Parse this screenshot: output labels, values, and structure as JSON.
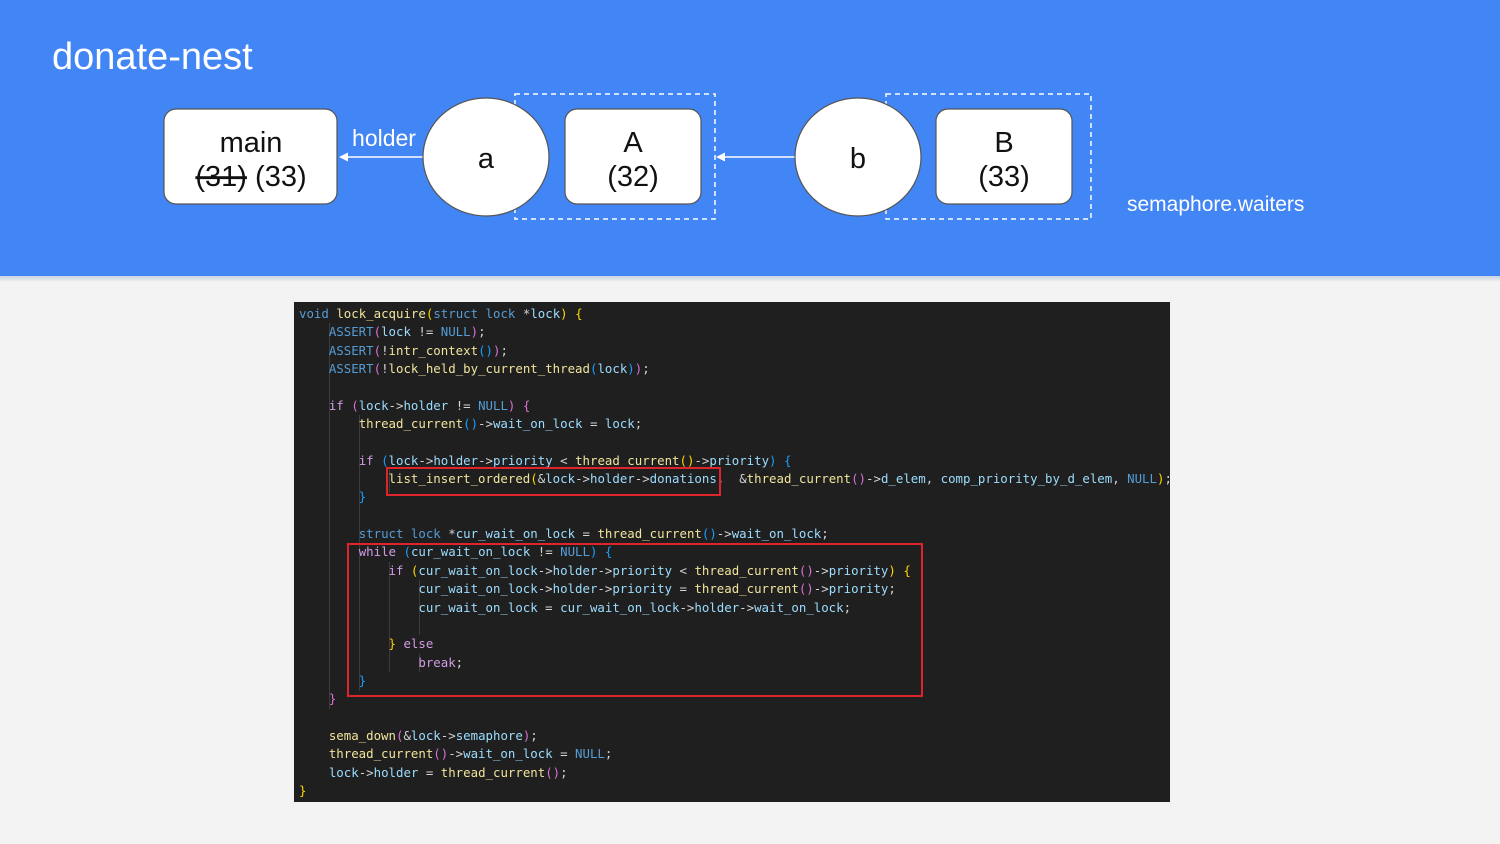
{
  "slide": {
    "title": "donate-nest"
  },
  "diagram": {
    "threads": [
      {
        "id": "main",
        "name": "main",
        "old_priority": "(31)",
        "priority": "(33)"
      },
      {
        "id": "A",
        "name": "A",
        "priority": "(32)"
      },
      {
        "id": "B",
        "name": "B",
        "priority": "(33)"
      }
    ],
    "locks": [
      {
        "id": "a",
        "label": "a"
      },
      {
        "id": "b",
        "label": "b"
      }
    ],
    "edge_label": "holder",
    "waiters_label": "semaphore.waiters"
  },
  "code": {
    "language": "c",
    "lines": [
      [
        [
          "ty",
          "void"
        ],
        [
          "op",
          " "
        ],
        [
          "fn",
          "lock_acquire"
        ],
        [
          "br1",
          "("
        ],
        [
          "ty",
          "struct"
        ],
        [
          "op",
          " "
        ],
        [
          "ty",
          "lock"
        ],
        [
          "op",
          " *"
        ],
        [
          "id",
          "lock"
        ],
        [
          "br1",
          ")"
        ],
        [
          "op",
          " "
        ],
        [
          "br1",
          "{"
        ]
      ],
      [
        [
          "op",
          "    "
        ],
        [
          "ty",
          "ASSERT"
        ],
        [
          "br2",
          "("
        ],
        [
          "id",
          "lock"
        ],
        [
          "op",
          " != "
        ],
        [
          "ty",
          "NULL"
        ],
        [
          "br2",
          ")"
        ],
        [
          "op",
          ";"
        ]
      ],
      [
        [
          "op",
          "    "
        ],
        [
          "ty",
          "ASSERT"
        ],
        [
          "br2",
          "("
        ],
        [
          "op",
          "!"
        ],
        [
          "fn",
          "intr_context"
        ],
        [
          "br3",
          "()"
        ],
        [
          "br2",
          ")"
        ],
        [
          "op",
          ";"
        ]
      ],
      [
        [
          "op",
          "    "
        ],
        [
          "ty",
          "ASSERT"
        ],
        [
          "br2",
          "("
        ],
        [
          "op",
          "!"
        ],
        [
          "fn",
          "lock_held_by_current_thread"
        ],
        [
          "br3",
          "("
        ],
        [
          "id",
          "lock"
        ],
        [
          "br3",
          ")"
        ],
        [
          "br2",
          ")"
        ],
        [
          "op",
          ";"
        ]
      ],
      [
        [
          "op",
          ""
        ]
      ],
      [
        [
          "op",
          "    "
        ],
        [
          "kw",
          "if"
        ],
        [
          "op",
          " "
        ],
        [
          "br2",
          "("
        ],
        [
          "id",
          "lock"
        ],
        [
          "op",
          "->"
        ],
        [
          "id",
          "holder"
        ],
        [
          "op",
          " != "
        ],
        [
          "ty",
          "NULL"
        ],
        [
          "br2",
          ")"
        ],
        [
          "op",
          " "
        ],
        [
          "br2",
          "{"
        ]
      ],
      [
        [
          "op",
          "        "
        ],
        [
          "fn",
          "thread_current"
        ],
        [
          "br3",
          "()"
        ],
        [
          "op",
          "->"
        ],
        [
          "id",
          "wait_on_lock"
        ],
        [
          "op",
          " = "
        ],
        [
          "id",
          "lock"
        ],
        [
          "op",
          ";"
        ]
      ],
      [
        [
          "op",
          ""
        ]
      ],
      [
        [
          "op",
          "        "
        ],
        [
          "kw",
          "if"
        ],
        [
          "op",
          " "
        ],
        [
          "br3",
          "("
        ],
        [
          "id",
          "lock"
        ],
        [
          "op",
          "->"
        ],
        [
          "id",
          "holder"
        ],
        [
          "op",
          "->"
        ],
        [
          "id",
          "priority"
        ],
        [
          "op",
          " < "
        ],
        [
          "fn",
          "thread_current"
        ],
        [
          "br1",
          "()"
        ],
        [
          "op",
          "->"
        ],
        [
          "id",
          "priority"
        ],
        [
          "br3",
          ")"
        ],
        [
          "op",
          " "
        ],
        [
          "br3",
          "{"
        ]
      ],
      [
        [
          "op",
          "            "
        ],
        [
          "fn",
          "list_insert_ordered"
        ],
        [
          "br1",
          "("
        ],
        [
          "op",
          "&"
        ],
        [
          "id",
          "lock"
        ],
        [
          "op",
          "->"
        ],
        [
          "id",
          "holder"
        ],
        [
          "op",
          "->"
        ],
        [
          "id",
          "donations"
        ],
        [
          "op",
          ",  &"
        ],
        [
          "fn",
          "thread_current"
        ],
        [
          "br2",
          "()"
        ],
        [
          "op",
          "->"
        ],
        [
          "id",
          "d_elem"
        ],
        [
          "op",
          ", "
        ],
        [
          "id",
          "comp_priority_by_d_elem"
        ],
        [
          "op",
          ", "
        ],
        [
          "ty",
          "NULL"
        ],
        [
          "br1",
          ")"
        ],
        [
          "op",
          ";"
        ]
      ],
      [
        [
          "op",
          "        "
        ],
        [
          "br3",
          "}"
        ]
      ],
      [
        [
          "op",
          ""
        ]
      ],
      [
        [
          "op",
          "        "
        ],
        [
          "ty",
          "struct"
        ],
        [
          "op",
          " "
        ],
        [
          "ty",
          "lock"
        ],
        [
          "op",
          " *"
        ],
        [
          "id",
          "cur_wait_on_lock"
        ],
        [
          "op",
          " = "
        ],
        [
          "fn",
          "thread_current"
        ],
        [
          "br3",
          "()"
        ],
        [
          "op",
          "->"
        ],
        [
          "id",
          "wait_on_lock"
        ],
        [
          "op",
          ";"
        ]
      ],
      [
        [
          "op",
          "        "
        ],
        [
          "kw",
          "while"
        ],
        [
          "op",
          " "
        ],
        [
          "br3",
          "("
        ],
        [
          "id",
          "cur_wait_on_lock"
        ],
        [
          "op",
          " != "
        ],
        [
          "ty",
          "NULL"
        ],
        [
          "br3",
          ")"
        ],
        [
          "op",
          " "
        ],
        [
          "br3",
          "{"
        ]
      ],
      [
        [
          "op",
          "            "
        ],
        [
          "kw",
          "if"
        ],
        [
          "op",
          " "
        ],
        [
          "br1",
          "("
        ],
        [
          "id",
          "cur_wait_on_lock"
        ],
        [
          "op",
          "->"
        ],
        [
          "id",
          "holder"
        ],
        [
          "op",
          "->"
        ],
        [
          "id",
          "priority"
        ],
        [
          "op",
          " < "
        ],
        [
          "fn",
          "thread_current"
        ],
        [
          "br2",
          "()"
        ],
        [
          "op",
          "->"
        ],
        [
          "id",
          "priority"
        ],
        [
          "br1",
          ")"
        ],
        [
          "op",
          " "
        ],
        [
          "br1",
          "{"
        ]
      ],
      [
        [
          "op",
          "                "
        ],
        [
          "id",
          "cur_wait_on_lock"
        ],
        [
          "op",
          "->"
        ],
        [
          "id",
          "holder"
        ],
        [
          "op",
          "->"
        ],
        [
          "id",
          "priority"
        ],
        [
          "op",
          " = "
        ],
        [
          "fn",
          "thread_current"
        ],
        [
          "br2",
          "()"
        ],
        [
          "op",
          "->"
        ],
        [
          "id",
          "priority"
        ],
        [
          "op",
          ";"
        ]
      ],
      [
        [
          "op",
          "                "
        ],
        [
          "id",
          "cur_wait_on_lock"
        ],
        [
          "op",
          " = "
        ],
        [
          "id",
          "cur_wait_on_lock"
        ],
        [
          "op",
          "->"
        ],
        [
          "id",
          "holder"
        ],
        [
          "op",
          "->"
        ],
        [
          "id",
          "wait_on_lock"
        ],
        [
          "op",
          ";"
        ]
      ],
      [
        [
          "op",
          ""
        ]
      ],
      [
        [
          "op",
          "            "
        ],
        [
          "br1",
          "}"
        ],
        [
          "op",
          " "
        ],
        [
          "kw",
          "else"
        ]
      ],
      [
        [
          "op",
          "                "
        ],
        [
          "kw",
          "break"
        ],
        [
          "op",
          ";"
        ]
      ],
      [
        [
          "op",
          "        "
        ],
        [
          "br3",
          "}"
        ]
      ],
      [
        [
          "op",
          "    "
        ],
        [
          "br2",
          "}"
        ]
      ],
      [
        [
          "op",
          ""
        ]
      ],
      [
        [
          "op",
          "    "
        ],
        [
          "fn",
          "sema_down"
        ],
        [
          "br2",
          "("
        ],
        [
          "op",
          "&"
        ],
        [
          "id",
          "lock"
        ],
        [
          "op",
          "->"
        ],
        [
          "id",
          "semaphore"
        ],
        [
          "br2",
          ")"
        ],
        [
          "op",
          ";"
        ]
      ],
      [
        [
          "op",
          "    "
        ],
        [
          "fn",
          "thread_current"
        ],
        [
          "br2",
          "()"
        ],
        [
          "op",
          "->"
        ],
        [
          "id",
          "wait_on_lock"
        ],
        [
          "op",
          " = "
        ],
        [
          "ty",
          "NULL"
        ],
        [
          "op",
          ";"
        ]
      ],
      [
        [
          "op",
          "    "
        ],
        [
          "id",
          "lock"
        ],
        [
          "op",
          "->"
        ],
        [
          "id",
          "holder"
        ],
        [
          "op",
          " = "
        ],
        [
          "fn",
          "thread_current"
        ],
        [
          "br2",
          "()"
        ],
        [
          "op",
          ";"
        ]
      ],
      [
        [
          "br1",
          "}"
        ]
      ]
    ]
  },
  "colors": {
    "banner": "#4285f4",
    "highlight": "#e0242b",
    "code_background": "#1f1f1f"
  }
}
